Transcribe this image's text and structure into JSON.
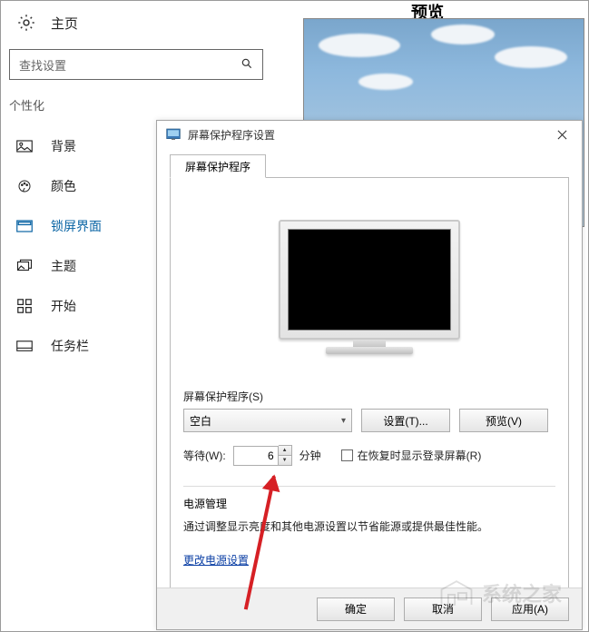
{
  "settings": {
    "home": "主页",
    "search_placeholder": "查找设置",
    "section": "个性化",
    "nav": {
      "background": "背景",
      "colors": "颜色",
      "lockscreen": "锁屏界面",
      "themes": "主题",
      "start": "开始",
      "taskbar": "任务栏"
    },
    "preview_heading": "预览"
  },
  "dialog": {
    "title": "屏幕保护程序设置",
    "tab_label": "屏幕保护程序",
    "saver_label": "屏幕保护程序(S)",
    "saver_value": "空白",
    "settings_btn": "设置(T)...",
    "preview_btn": "预览(V)",
    "wait_label": "等待(W):",
    "wait_value": "6",
    "wait_unit": "分钟",
    "resume_checkbox": "在恢复时显示登录屏幕(R)",
    "power_title": "电源管理",
    "power_desc": "通过调整显示亮度和其他电源设置以节省能源或提供最佳性能。",
    "power_link": "更改电源设置",
    "ok_btn": "确定",
    "cancel_btn": "取消",
    "apply_btn": "应用(A)"
  },
  "watermark": "系统之家"
}
